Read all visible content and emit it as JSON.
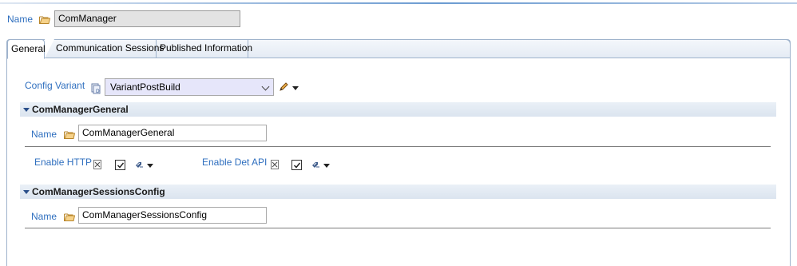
{
  "header": {
    "name_label": "Name",
    "name_value": "ComManager"
  },
  "tabs": [
    {
      "label": "General",
      "active": true
    },
    {
      "label": "Communication Sessions",
      "active": false
    },
    {
      "label": "Published Information",
      "active": false
    }
  ],
  "general": {
    "config_variant_label": "Config Variant",
    "config_variant_value": "VariantPostBuild",
    "sections": [
      {
        "title": "ComManagerGeneral",
        "name_label": "Name",
        "name_value": "ComManagerGeneral",
        "enable_http_label": "Enable HTTP",
        "enable_det_api_label": "Enable Det API"
      },
      {
        "title": "ComManagerSessionsConfig",
        "name_label": "Name",
        "name_value": "ComManagerSessionsConfig"
      }
    ]
  },
  "colors": {
    "label_blue": "#2f6fbf",
    "combo_background": "#e6e6fa",
    "section_bar": "#dbe4ef"
  },
  "icons": [
    "folder-icon",
    "variant-icon",
    "edit-pencil-icon",
    "dropdown-arrow-icon",
    "excel-icon",
    "checkbox-checked-icon",
    "link-icon"
  ]
}
